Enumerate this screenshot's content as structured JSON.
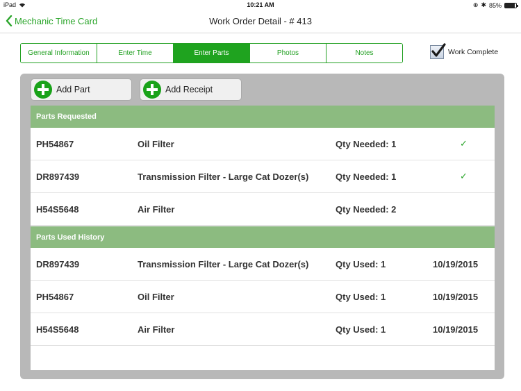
{
  "status_bar": {
    "device": "iPad",
    "time": "10:21 AM",
    "battery": "85%",
    "battery_level": 0.85
  },
  "navbar": {
    "back_label": "Mechanic Time Card",
    "title": "Work Order Detail - # 413"
  },
  "tabs": [
    {
      "label": "General Information",
      "active": false
    },
    {
      "label": "Enter Time",
      "active": false
    },
    {
      "label": "Enter Parts",
      "active": true
    },
    {
      "label": "Photos",
      "active": false
    },
    {
      "label": "Notes",
      "active": false
    }
  ],
  "work_complete": {
    "label": "Work Complete",
    "checked": true
  },
  "actions": {
    "add_part": "Add Part",
    "add_receipt": "Add Receipt"
  },
  "parts_requested": {
    "header": "Parts Requested",
    "rows": [
      {
        "part_no": "PH54867",
        "description": "Oil Filter",
        "qty": "Qty Needed: 1",
        "received": true
      },
      {
        "part_no": "DR897439",
        "description": "Transmission Filter - Large Cat Dozer(s)",
        "qty": "Qty Needed: 1",
        "received": true
      },
      {
        "part_no": "H54S5648",
        "description": "Air Filter",
        "qty": "Qty Needed: 2",
        "received": false
      }
    ]
  },
  "parts_used": {
    "header": "Parts Used History",
    "rows": [
      {
        "part_no": "DR897439",
        "description": "Transmission Filter - Large Cat Dozer(s)",
        "qty": "Qty Used: 1",
        "date": "10/19/2015"
      },
      {
        "part_no": "PH54867",
        "description": "Oil Filter",
        "qty": "Qty Used: 1",
        "date": "10/19/2015"
      },
      {
        "part_no": "H54S5648",
        "description": "Air Filter",
        "qty": "Qty Used: 1",
        "date": "10/19/2015"
      }
    ]
  },
  "colors": {
    "accent": "#1fa31f",
    "section_header": "#8cbb80",
    "panel": "#b8b8b8"
  }
}
